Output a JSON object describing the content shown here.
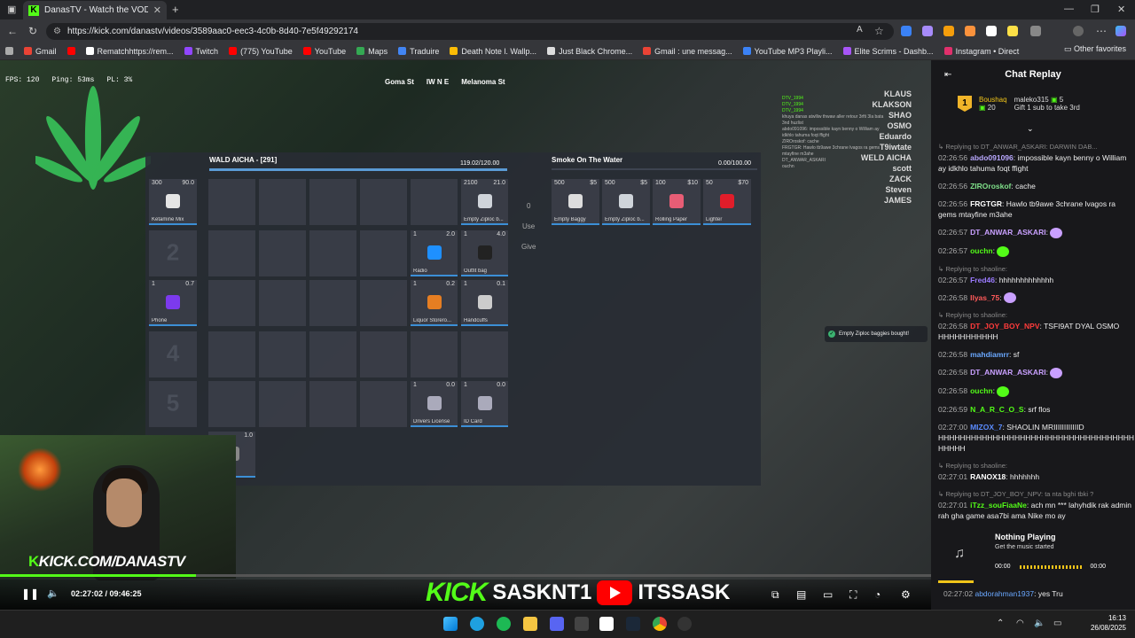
{
  "browser": {
    "tab_title": "DanasTV - Watch the VOD o...",
    "url": "https://kick.com/danastv/videos/3589aac0-eec3-4c0b-8d40-7e5f49292174",
    "bookmarks": [
      "Gmail",
      "Rematchhttps://rem...",
      "Twitch",
      "(775) YouTube",
      "YouTube",
      "Maps",
      "Traduire",
      "Death Note l. Wallp...",
      "Just Black Chrome...",
      "Gmail : une messag...",
      "YouTube MP3 Playli...",
      "Elite Scrims - Dashb...",
      "Instagram • Direct"
    ],
    "other_bookmarks": "Other favorites"
  },
  "game": {
    "stats": {
      "fps": "FPS: 120",
      "ping": "Ping: 53ms",
      "pl": "PL: 3%"
    },
    "street_left": "Goma St",
    "compass": "IW N E",
    "street_right": "Melanoma St",
    "inventory_title": "WALD AICHA - [291]",
    "inventory_weight": "119.02/120.00",
    "shop_title": "Smoke On The Water",
    "shop_weight": "0.00/100.00",
    "use_label": "Use",
    "give_label": "Give",
    "qty_label": "0",
    "hotbar": [
      {
        "q": "300",
        "w": "90.0",
        "n": "Ketamine Mix"
      },
      {
        "num": "2"
      },
      {
        "q": "1",
        "w": "0.7",
        "n": "Phone"
      },
      {
        "num": "4"
      },
      {
        "num": "5"
      }
    ],
    "items": [
      {
        "q": "2100",
        "w": "21.0",
        "n": "Empty Ziploc b..."
      },
      {
        "q": "1",
        "w": "2.0",
        "n": "Radio"
      },
      {
        "q": "1",
        "w": "4.0",
        "n": "Outfit bag"
      },
      {
        "q": "1",
        "w": "0.2",
        "n": "Liquor Storero..."
      },
      {
        "q": "1",
        "w": "0.1",
        "n": "Handcuffs"
      },
      {
        "q": "1",
        "w": "0.0",
        "n": "Drivers License"
      },
      {
        "q": "1",
        "w": "0.0",
        "n": "ID Card"
      }
    ],
    "extra_slot": {
      "w": "1.0",
      "n": "ade"
    },
    "shop_items": [
      {
        "q": "500",
        "p": "$5",
        "n": "Empty Baggy"
      },
      {
        "q": "500",
        "p": "$5",
        "n": "Empty Ziploc b..."
      },
      {
        "q": "100",
        "p": "$10",
        "n": "Rolling Paper"
      },
      {
        "q": "50",
        "p": "$70",
        "n": "Lighter"
      }
    ],
    "notification": "Empty Ziploc baggies bought!",
    "players": [
      "KLAUS",
      "KLAKSON",
      "SHAO",
      "OSMO",
      "Eduardo",
      "T9iwtate",
      "WELD AICHA",
      "scott",
      "ZACK",
      "Steven",
      "JAMES"
    ],
    "ingame_chat": [
      "DTV_1994",
      "DTV_1994",
      "DTV_1994",
      "khuya danas atwlliw thwaw aller retour 3rfti 3la bata 3nd huzlist",
      "abdo091096: impossible kayn benny o William ay idkhlo tahuma foqt ffight",
      "ZIROroskof: cache",
      "FRGTGR: Hawlo tb9awe 3chrane lvagos ra gems mtayfine m3ahe",
      "DT_ANWAR_ASKARI",
      "ouchn"
    ]
  },
  "stream": {
    "webcam_url": "KICK.COM/DANASTV",
    "time": "02:27:02 / 09:46:25",
    "banner_kick": "KICK",
    "banner_kick_name": "SASKNT1",
    "banner_yt_name": "ITSSASK",
    "progress": 0.21
  },
  "chat": {
    "title": "Chat Replay",
    "leader1_name": "Boushaq",
    "leader1_count": "20",
    "leader2_name": "maleko315",
    "leader2_count": "5",
    "leader2_text": "Gift 1 sub to take 3rd",
    "messages": [
      {
        "reply": "Replying to DT_ANWAR_ASKARI: DARWIN DAB...",
        "ts": "02:26:56",
        "user": "abdo091096",
        "color": "#b9a8ff",
        "text": "impossible kayn benny o William ay idkhlo tahuma foqt ffight"
      },
      {
        "ts": "02:26:56",
        "user": "ZIROroskof",
        "color": "#7fe08a",
        "text": "cache"
      },
      {
        "ts": "02:26:56",
        "user": "FRGTGR",
        "color": "#ffffff",
        "text": "Hawlo tb9awe 3chrane lvagos ra gems mtayfine m3ahe"
      },
      {
        "ts": "02:26:57",
        "user": "DT_ANWAR_ASKARI",
        "color": "#c9a0ff",
        "text": ""
      },
      {
        "ts": "02:26:57",
        "user": "ouchn",
        "color": "#53fc18",
        "text": ""
      },
      {
        "reply": "Replying to shaoline:",
        "ts": "02:26:57",
        "user": "Fred46",
        "color": "#9b7bff",
        "text": "hhhhhhhhhhhhh"
      },
      {
        "ts": "02:26:58",
        "user": "Ilyas_75",
        "color": "#ff5a5a",
        "text": ""
      },
      {
        "reply": "Replying to shaoline:",
        "ts": "02:26:58",
        "user": "DT_JOY_BOY_NPV",
        "color": "#ff3b3b",
        "text": "TSFI9AT DYAL OSMO HHHHHHHHHHH"
      },
      {
        "ts": "02:26:58",
        "user": "mahdiamrr",
        "color": "#6aa8ff",
        "text": "sf"
      },
      {
        "ts": "02:26:58",
        "user": "DT_ANWAR_ASKARI",
        "color": "#c9a0ff",
        "text": ""
      },
      {
        "ts": "02:26:58",
        "user": "ouchn",
        "color": "#53fc18",
        "text": ""
      },
      {
        "ts": "02:26:59",
        "user": "N_A_R_C_O_S",
        "color": "#53fc18",
        "text": "srf flos"
      },
      {
        "ts": "02:27:00",
        "user": "MIZOX_7",
        "color": "#5b8cff",
        "text": "SHAOLIN MRIIIIIIIIIIIID HHHHHHHHHHHHHHHHHHHHHHHHHHHHHHHHHHHH HHHHH"
      },
      {
        "reply": "Replying to shaoline:",
        "ts": "02:27:01",
        "user": "RANOX18",
        "color": "#ffffff",
        "text": "hhhhhhh"
      },
      {
        "reply": "Replying to DT_JOY_BOY_NPV: ta nta bghi tbki ?",
        "ts": "02:27:01",
        "user": "iTzz_souFiaaNe",
        "color": "#53fc18",
        "text": "ach mn *** lahyhdik rak admin rah gha game asa7bi ama Nike mo ay"
      }
    ],
    "last_msg": {
      "ts": "02:27:02",
      "user": "abdorahman1937",
      "color": "#6aa8ff",
      "text": "yes Tru"
    },
    "now_playing_title": "Nothing Playing",
    "now_playing_sub": "Get the music started",
    "now_playing_t1": "00:00",
    "now_playing_t2": "00:00"
  },
  "taskbar": {
    "time": "16:13",
    "date": "26/08/2025"
  }
}
